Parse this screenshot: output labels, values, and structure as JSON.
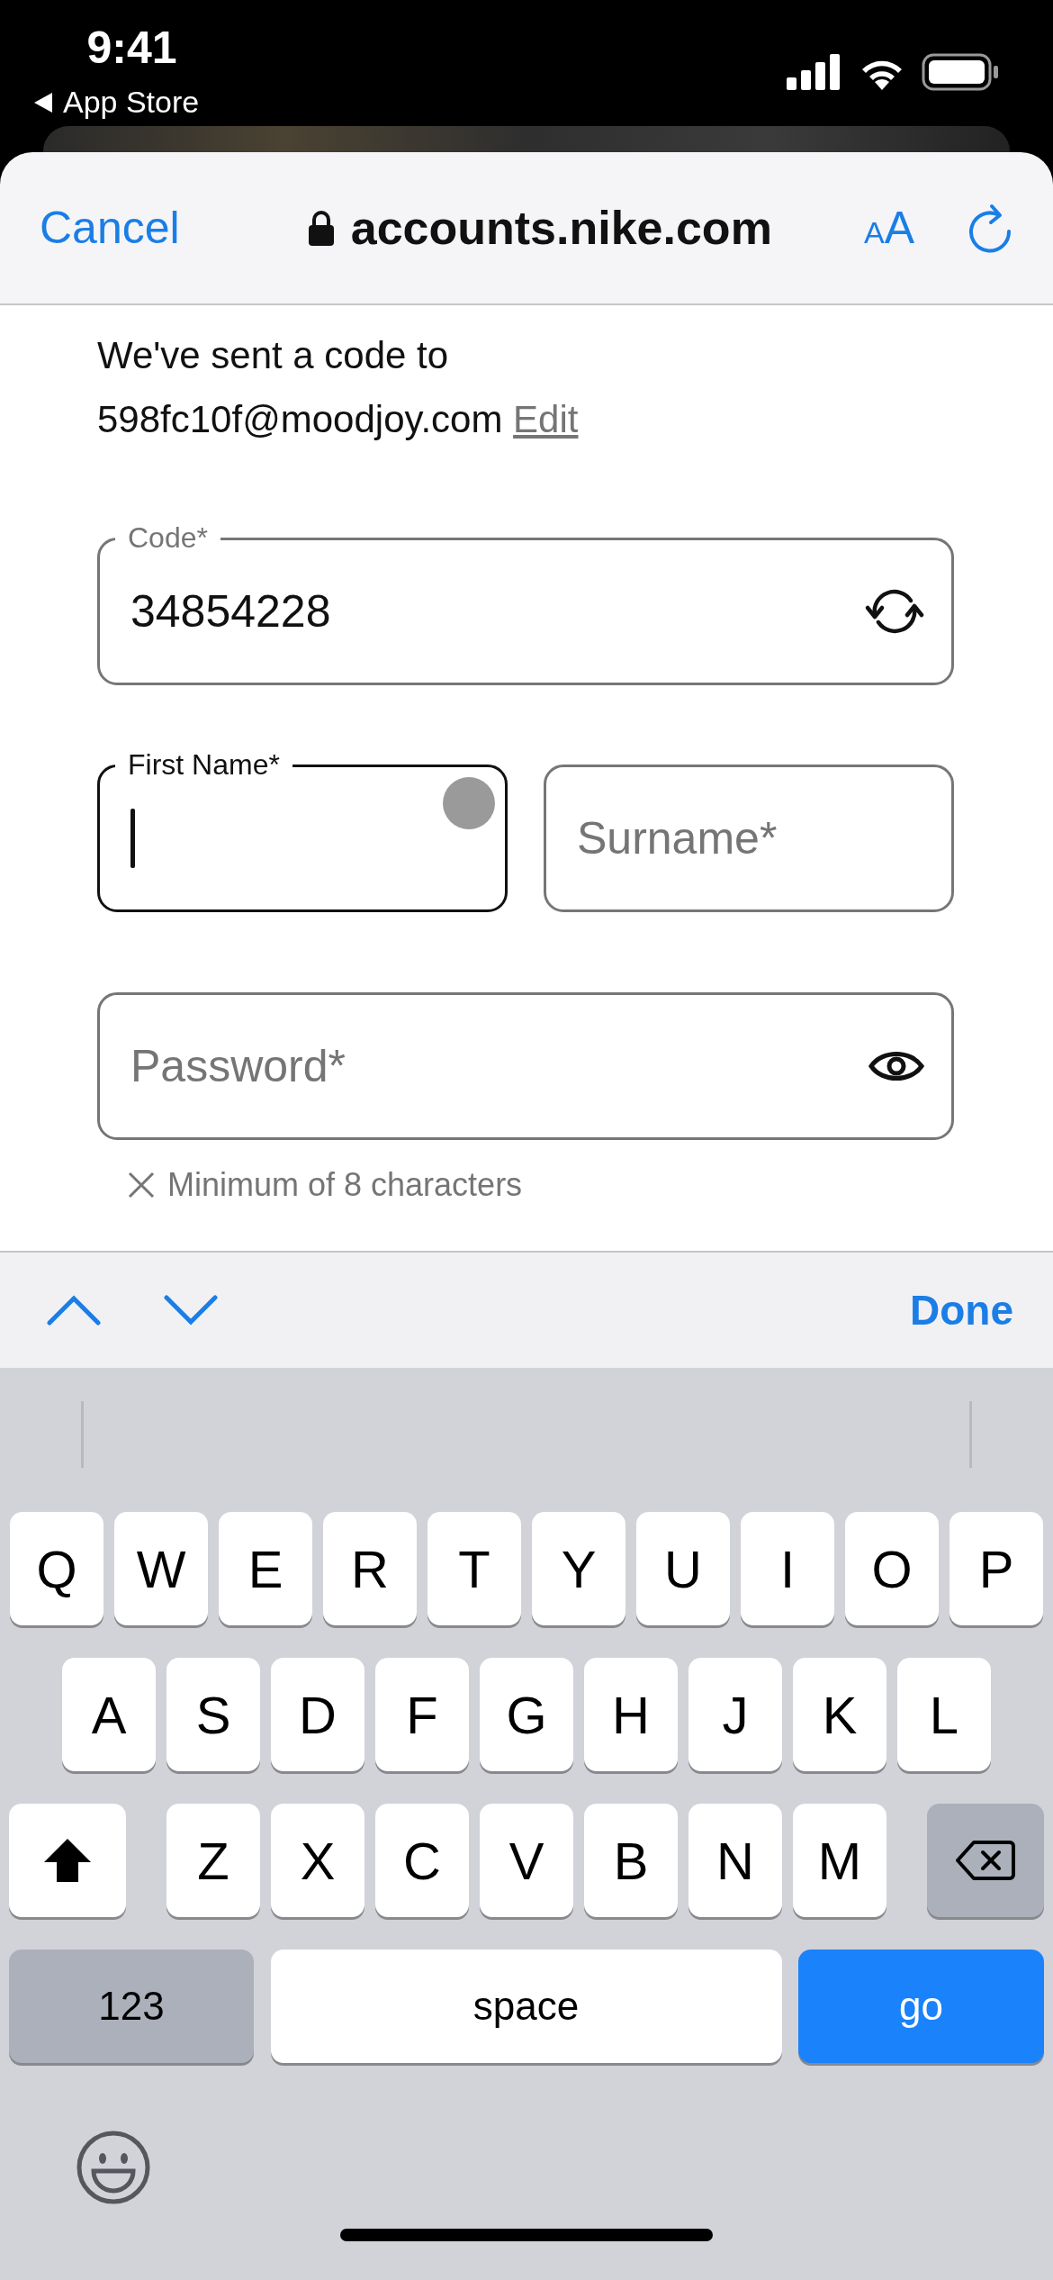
{
  "status_bar": {
    "time": "9:41",
    "back_label": "App Store"
  },
  "browser_bar": {
    "cancel": "Cancel",
    "url": "accounts.nike.com",
    "text_size": "AA"
  },
  "message": {
    "text": "We've sent a code to 598fc10f@moodjoy.com",
    "link": "Edit"
  },
  "code_field": {
    "label": "Code*",
    "value": "34854228",
    "focused": false
  },
  "name_fields": [
    {
      "label": "First Name*",
      "focused": true
    },
    {
      "placeholder": "Surname*",
      "focused": false
    }
  ],
  "password_field": {
    "placeholder": "Password*",
    "focused": false
  },
  "requirements": [
    {
      "text": "Minimum of 8 characters",
      "met": false
    }
  ],
  "accessory_bar": {
    "done": "Done"
  },
  "keyboard": {
    "rows": [
      [
        "Q",
        "W",
        "E",
        "R",
        "T",
        "Y",
        "U",
        "I",
        "O",
        "P"
      ],
      [
        "A",
        "S",
        "D",
        "F",
        "G",
        "H",
        "J",
        "K",
        "L"
      ],
      [
        "Z",
        "X",
        "C",
        "V",
        "B",
        "N",
        "M"
      ]
    ],
    "mode_key": "123",
    "space": "space",
    "action_key": "go"
  }
}
